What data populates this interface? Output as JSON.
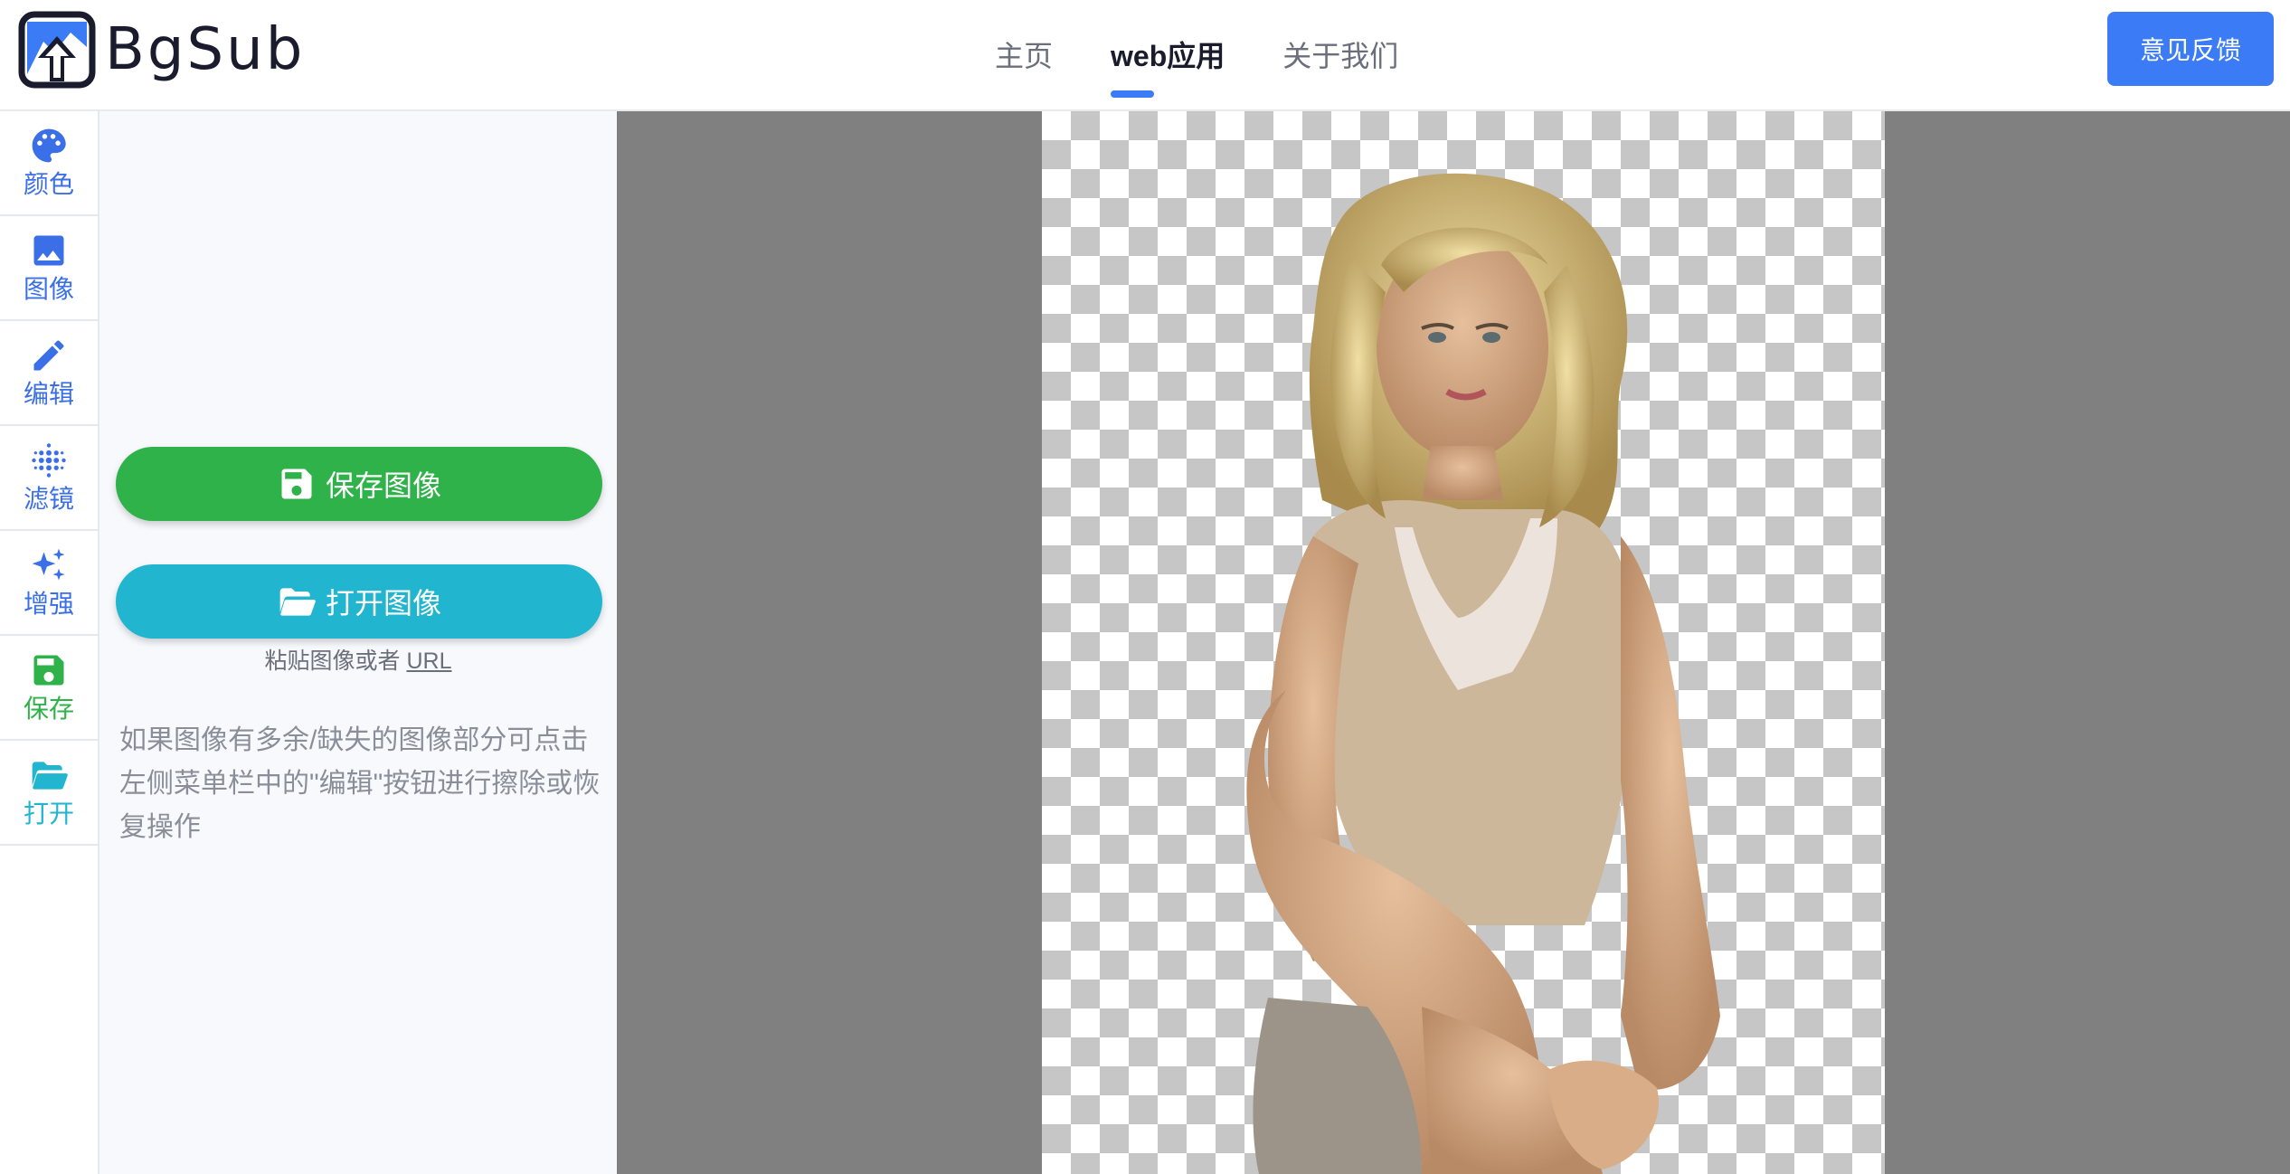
{
  "header": {
    "logo_text": "BgSub",
    "nav": [
      {
        "label": "主页",
        "active": false
      },
      {
        "label": "web应用",
        "active": true
      },
      {
        "label": "关于我们",
        "active": false
      }
    ],
    "feedback_label": "意见反馈",
    "accent_color": "#3b7bf6"
  },
  "rail": {
    "items": [
      {
        "label": "颜色",
        "icon": "palette-icon",
        "color": "#3b6fe8"
      },
      {
        "label": "图像",
        "icon": "image-icon",
        "color": "#3b6fe8"
      },
      {
        "label": "编辑",
        "icon": "pencil-icon",
        "color": "#3b6fe8"
      },
      {
        "label": "滤镜",
        "icon": "dots-grid-icon",
        "color": "#3b6fe8"
      },
      {
        "label": "增强",
        "icon": "sparkles-icon",
        "color": "#3b6fe8"
      },
      {
        "label": "保存",
        "icon": "floppy-disk-icon",
        "color": "#2fb24a"
      },
      {
        "label": "打开",
        "icon": "folder-open-icon",
        "color": "#22b5cf"
      }
    ]
  },
  "panel": {
    "save_label": "保存图像",
    "open_label": "打开图像",
    "paste_hint_prefix": "粘贴图像或者",
    "paste_hint_link": "URL",
    "tip": "如果图像有多余/缺失的图像部分可点击左侧菜单栏中的\"编辑\"按钮进行擦除或恢复操作",
    "save_color": "#2fb24a",
    "open_color": "#22b5cf"
  },
  "canvas": {
    "background_color": "#808080",
    "transparency_pattern": "checkerboard"
  }
}
